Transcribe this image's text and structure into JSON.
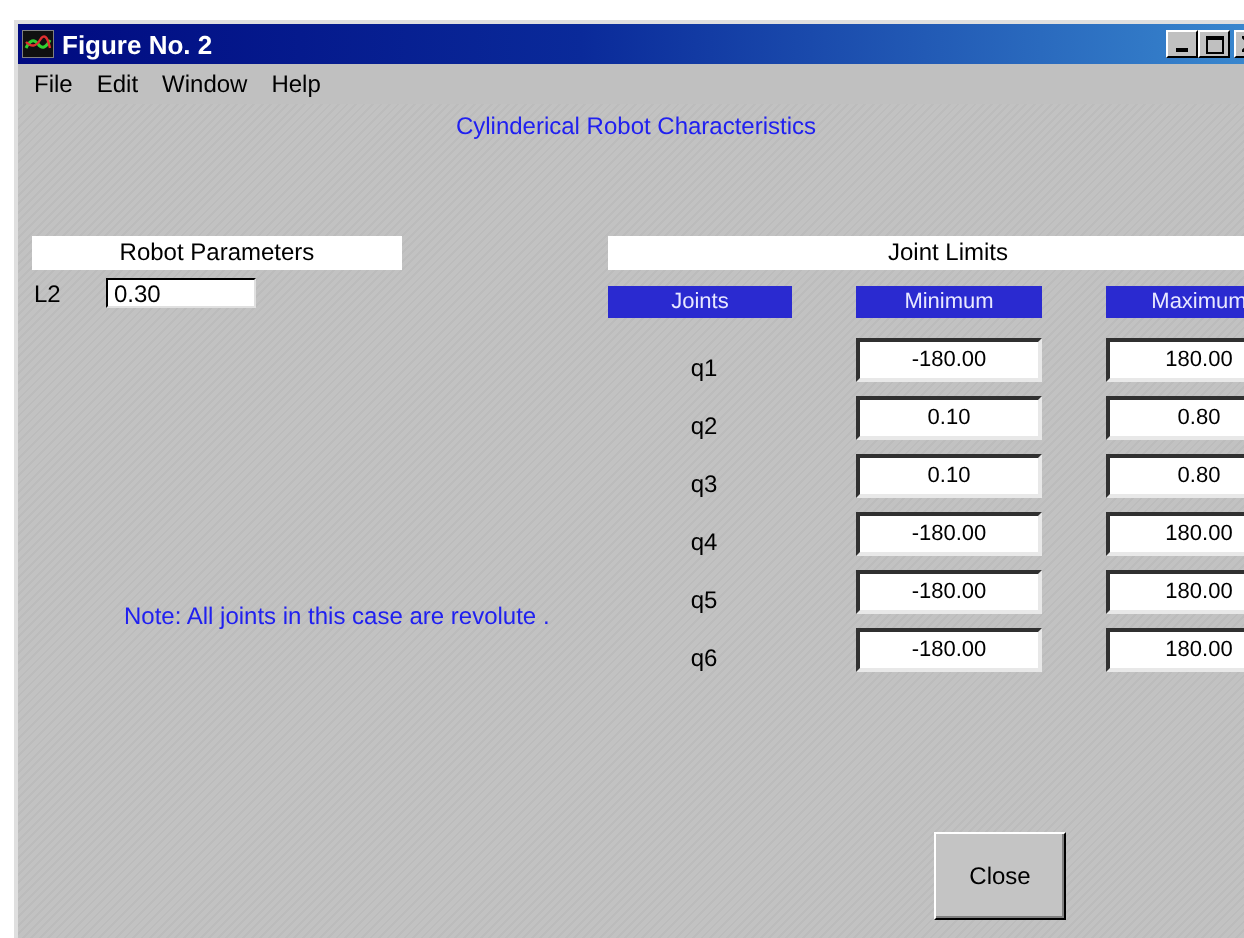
{
  "window": {
    "title": "Figure No. 2"
  },
  "menu": [
    "File",
    "Edit",
    "Window",
    "Help"
  ],
  "heading": "Cylinderical Robot Characteristics",
  "robot_parameters": {
    "title": "Robot Parameters",
    "fields": [
      {
        "label": "L2",
        "value": "0.30"
      }
    ]
  },
  "joint_limits": {
    "title": "Joint Limits",
    "columns": [
      "Joints",
      "Minimum",
      "Maximum"
    ],
    "rows": [
      {
        "joint": "q1",
        "minimum": "-180.00",
        "maximum": "180.00"
      },
      {
        "joint": "q2",
        "minimum": "0.10",
        "maximum": "0.80"
      },
      {
        "joint": "q3",
        "minimum": "0.10",
        "maximum": "0.80"
      },
      {
        "joint": "q4",
        "minimum": "-180.00",
        "maximum": "180.00"
      },
      {
        "joint": "q5",
        "minimum": "-180.00",
        "maximum": "180.00"
      },
      {
        "joint": "q6",
        "minimum": "-180.00",
        "maximum": "180.00"
      }
    ]
  },
  "note": "Note: All joints in this case are revolute .",
  "buttons": [
    "Close"
  ]
}
